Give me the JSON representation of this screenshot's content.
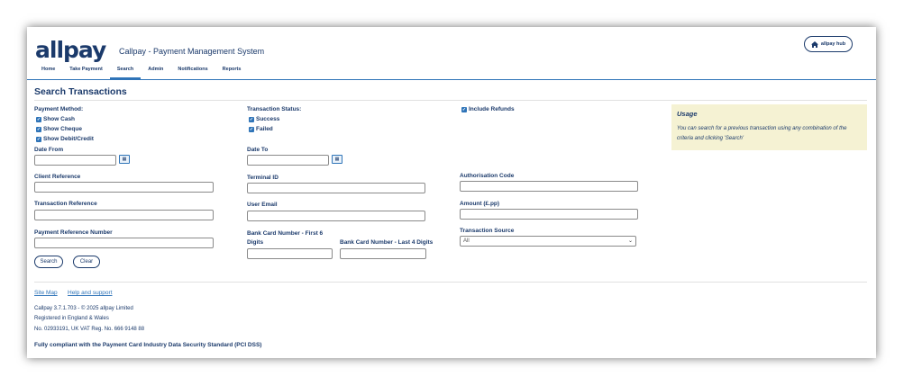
{
  "header": {
    "logo": "allpay",
    "app_title": "Callpay - Payment Management System",
    "hub_button": "allpay hub"
  },
  "nav": {
    "items": [
      "Home",
      "Take Payment",
      "Search",
      "Admin",
      "Notifications",
      "Reports"
    ],
    "active": "Search"
  },
  "page": {
    "title": "Search Transactions"
  },
  "form": {
    "payment_method_label": "Payment Method:",
    "show_cash": "Show Cash",
    "show_cheque": "Show Cheque",
    "show_debit_credit": "Show Debit/Credit",
    "transaction_status_label": "Transaction Status:",
    "success": "Success",
    "failed": "Failed",
    "include_refunds": "Include Refunds",
    "date_from": "Date From",
    "date_to": "Date To",
    "client_reference": "Client Reference",
    "terminal_id": "Terminal ID",
    "authorisation_code": "Authorisation Code",
    "transaction_reference": "Transaction Reference",
    "user_email": "User Email",
    "amount": "Amount (£.pp)",
    "payment_reference_number": "Payment Reference Number",
    "bank_card_first6_line1": "Bank Card Number - First 6",
    "bank_card_first6_line2": "Digits",
    "bank_card_last4": "Bank Card Number - Last 4 Digits",
    "transaction_source": "Transaction Source",
    "transaction_source_value": "All",
    "search_button": "Search",
    "clear_button": "Clear"
  },
  "usage": {
    "title": "Usage",
    "body": "You can search for a previous transaction using any combination of the criteria and clicking 'Search'"
  },
  "footer": {
    "site_map": "Site Map",
    "help": "Help and support",
    "version": "Callpay 3.7.1.703 - © 2025 allpay Limited",
    "registered": "Registered in England & Wales",
    "reg_no": "No. 02933191, UK VAT Reg. No. 666 9148 88",
    "pci": "Fully compliant with the Payment Card Industry Data Security Standard (PCI DSS)"
  },
  "colors": {
    "brand": "#1b3a6b",
    "accent": "#2f74b8",
    "usage_bg": "#f5f2d3"
  }
}
